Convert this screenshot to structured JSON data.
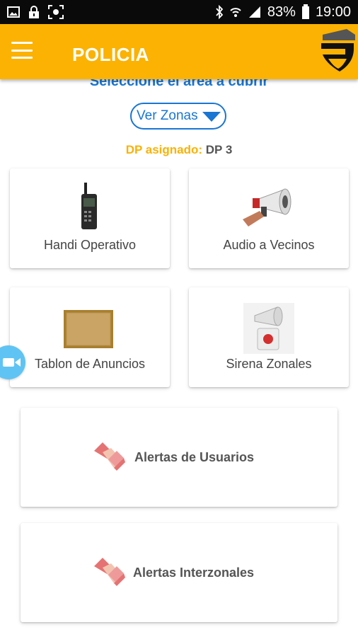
{
  "status_bar": {
    "battery_text": "83%",
    "time": "19:00",
    "icons": [
      "image-icon",
      "lock-icon",
      "screenshot-icon",
      "bluetooth-icon",
      "wifi-icon",
      "signal-icon",
      "battery-icon"
    ]
  },
  "app_bar": {
    "title": "POLICIA",
    "menu_icon": "hamburger-icon",
    "logo": "shield-logo"
  },
  "main": {
    "section_title": "Seleccione el área a cubrir",
    "zone_select": {
      "label": "Ver Zonas",
      "icon": "dropdown-triangle-icon"
    },
    "dp": {
      "label": "DP asignado:",
      "value": "DP 3"
    }
  },
  "cards": [
    {
      "label": "Handi Operativo",
      "icon": "radio-icon"
    },
    {
      "label": "Audio a Vecinos",
      "icon": "megaphone-icon"
    },
    {
      "label": "Tablon de Anuncios",
      "icon": "corkboard-icon"
    },
    {
      "label": "Sirena Zonales",
      "icon": "siren-icon"
    }
  ],
  "wide_cards": [
    {
      "label": "Alertas de Usuarios",
      "icon": "handshake-icon"
    },
    {
      "label": "Alertas Interzonales",
      "icon": "handshake-icon"
    }
  ],
  "floating_button": {
    "icon": "video-camera-icon"
  },
  "colors": {
    "accent": "#fbb203",
    "link_blue": "#1976d2",
    "status_bar": "#0a0a0a",
    "fab": "#5fc4f3"
  }
}
